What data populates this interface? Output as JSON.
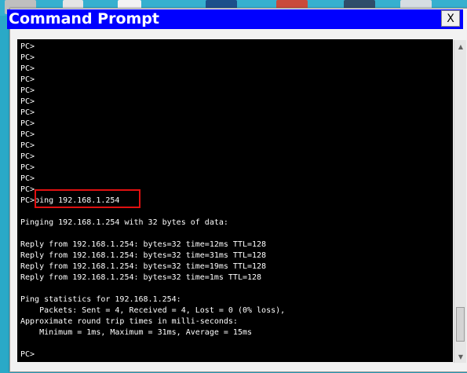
{
  "window": {
    "title": "Command Prompt",
    "close_label": "X",
    "colors": {
      "titlebar": "#0000ff",
      "terminal_bg": "#000000",
      "terminal_fg": "#ffffff",
      "highlight_border": "#e01010"
    }
  },
  "terminal": {
    "lines": [
      "PC>",
      "PC>",
      "PC>",
      "PC>",
      "PC>",
      "PC>",
      "PC>",
      "PC>",
      "PC>",
      "PC>",
      "PC>",
      "PC>",
      "PC>",
      "PC>",
      "PC>ping 192.168.1.254",
      "",
      "Pinging 192.168.1.254 with 32 bytes of data:",
      "",
      "Reply from 192.168.1.254: bytes=32 time=12ms TTL=128",
      "Reply from 192.168.1.254: bytes=32 time=31ms TTL=128",
      "Reply from 192.168.1.254: bytes=32 time=19ms TTL=128",
      "Reply from 192.168.1.254: bytes=32 time=1ms TTL=128",
      "",
      "Ping statistics for 192.168.1.254:",
      "    Packets: Sent = 4, Received = 4, Lost = 0 (0% loss),",
      "Approximate round trip times in milli-seconds:",
      "    Minimum = 1ms, Maximum = 31ms, Average = 15ms",
      "",
      "PC>"
    ],
    "highlighted_command": "ping 192.168.1.254"
  },
  "scrollbar": {
    "up_icon": "chevron-up-icon",
    "down_icon": "chevron-down-icon"
  }
}
